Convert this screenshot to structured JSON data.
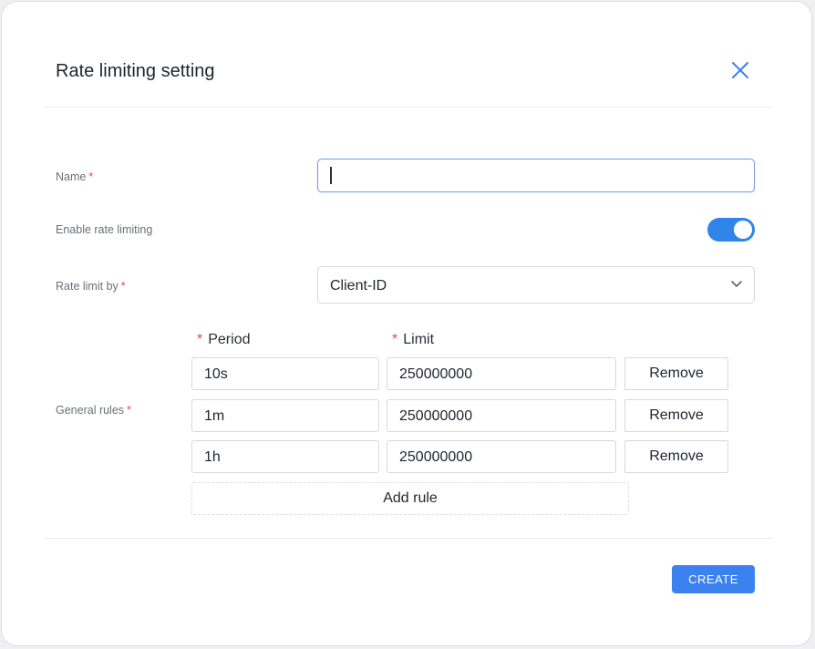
{
  "dialog": {
    "title": "Rate limiting setting",
    "close_icon": "close-icon"
  },
  "form": {
    "name": {
      "label": "Name",
      "required": "*",
      "value": ""
    },
    "enable": {
      "label": "Enable rate limiting",
      "on": true
    },
    "limit_by": {
      "label": "Rate limit by",
      "required": "*",
      "value": "Client-ID",
      "icon": "chevron-down-icon"
    },
    "rules": {
      "label": "General rules",
      "required": "*",
      "period_header": "Period",
      "limit_header": "Limit",
      "header_star": "*",
      "items": [
        {
          "period": "10s",
          "limit": "250000000",
          "remove": "Remove"
        },
        {
          "period": "1m",
          "limit": "250000000",
          "remove": "Remove"
        },
        {
          "period": "1h",
          "limit": "250000000",
          "remove": "Remove"
        }
      ],
      "add_rule": "Add rule"
    }
  },
  "footer": {
    "create": "CREATE"
  },
  "colors": {
    "accent": "#3b82f0",
    "toggle_on": "#2f86e8",
    "required": "#e5484d"
  }
}
